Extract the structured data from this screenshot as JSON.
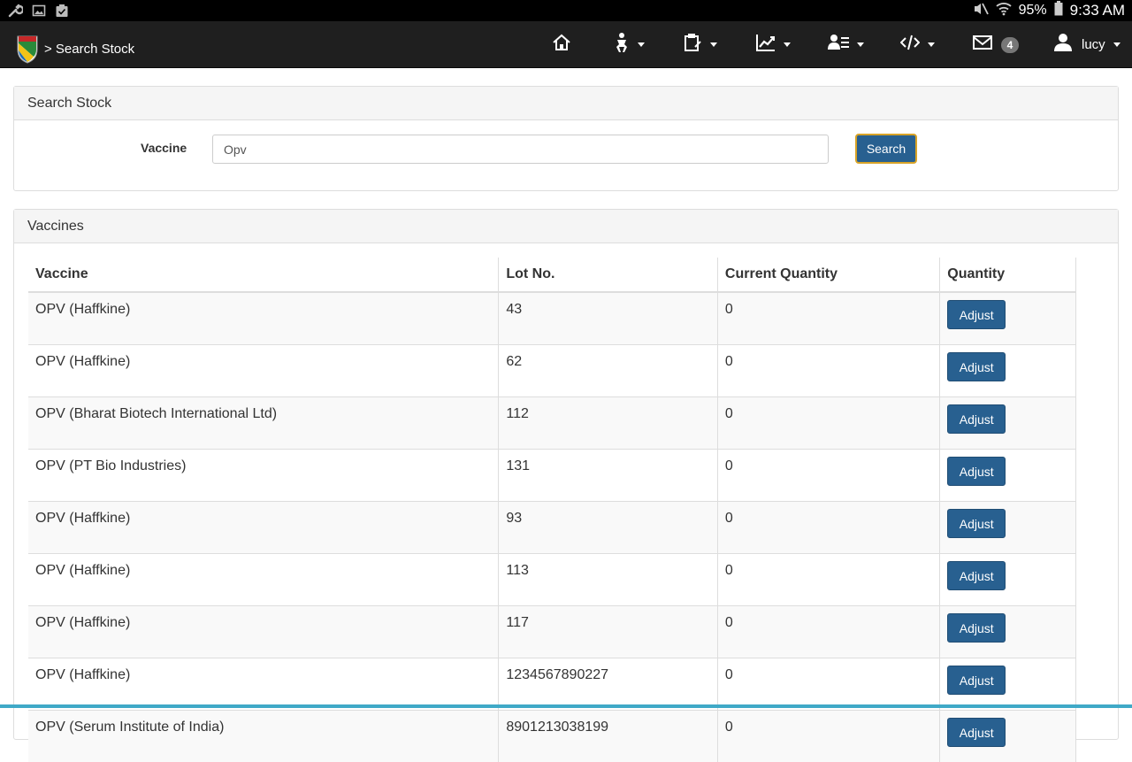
{
  "status_bar": {
    "left_icons": [
      "wrench-icon",
      "image-icon",
      "clipboard-check-icon"
    ],
    "right_icons": [
      "mute-icon",
      "wifi-icon",
      "battery-icon"
    ],
    "battery": "95%",
    "time": "9:33 AM"
  },
  "navbar": {
    "logo_icon": "timr-shield-logo",
    "breadcrumb": "> Search Stock",
    "items": [
      {
        "icon": "home-icon",
        "has_dropdown": false
      },
      {
        "icon": "child-icon",
        "has_dropdown": true
      },
      {
        "icon": "clipboard-icon",
        "has_dropdown": true
      },
      {
        "icon": "chart-line-icon",
        "has_dropdown": true
      },
      {
        "icon": "users-list-icon",
        "has_dropdown": true
      },
      {
        "icon": "code-icon",
        "has_dropdown": true
      },
      {
        "icon": "mail-icon",
        "has_dropdown": false
      }
    ],
    "mail_count": "4",
    "user": {
      "icon": "user-icon",
      "name": "lucy"
    }
  },
  "search_panel": {
    "title": "Search Stock",
    "vaccine_label": "Vaccine",
    "vaccine_value": "Opv",
    "search_button": "Search"
  },
  "vaccines_panel": {
    "title": "Vaccines",
    "columns": [
      "Vaccine",
      "Lot No.",
      "Current Quantity",
      "Quantity"
    ],
    "adjust_label": "Adjust",
    "rows": [
      {
        "vaccine": "OPV (Haffkine)",
        "lot": "43",
        "current_quantity": "0"
      },
      {
        "vaccine": "OPV (Haffkine)",
        "lot": "62",
        "current_quantity": "0"
      },
      {
        "vaccine": "OPV (Bharat Biotech International Ltd)",
        "lot": "112",
        "current_quantity": "0"
      },
      {
        "vaccine": "OPV (PT Bio Industries)",
        "lot": "131",
        "current_quantity": "0"
      },
      {
        "vaccine": "OPV (Haffkine)",
        "lot": "93",
        "current_quantity": "0"
      },
      {
        "vaccine": "OPV (Haffkine)",
        "lot": "113",
        "current_quantity": "0"
      },
      {
        "vaccine": "OPV (Haffkine)",
        "lot": "117",
        "current_quantity": "0"
      },
      {
        "vaccine": "OPV (Haffkine)",
        "lot": "1234567890227",
        "current_quantity": "0"
      },
      {
        "vaccine": "OPV (Serum Institute of India)",
        "lot": "8901213038199",
        "current_quantity": "0"
      }
    ]
  },
  "colors": {
    "navbar_bg": "#1f1f1f",
    "primary_button": "#286090",
    "focus_outline": "#d8a327",
    "panel_heading_bg": "#f5f5f5",
    "accent_line": "#3fa9c7"
  }
}
